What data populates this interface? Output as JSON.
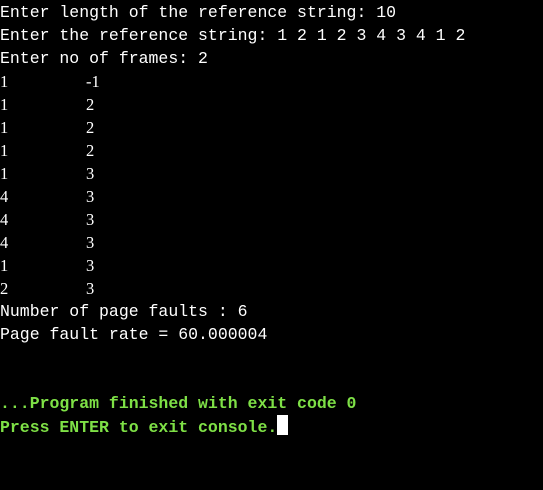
{
  "prompts": {
    "length_prompt": "Enter length of the reference string: 10",
    "string_prompt": "Enter the reference string: 1 2 1 2 3 4 3 4 1 2",
    "frames_prompt": "Enter no of frames: 2"
  },
  "frame_rows": [
    {
      "f1": "1",
      "f2": "-1"
    },
    {
      "f1": "1",
      "f2": "2"
    },
    {
      "f1": "1",
      "f2": "2"
    },
    {
      "f1": "1",
      "f2": "2"
    },
    {
      "f1": "1",
      "f2": "3"
    },
    {
      "f1": "4",
      "f2": "3"
    },
    {
      "f1": "4",
      "f2": "3"
    },
    {
      "f1": "4",
      "f2": "3"
    },
    {
      "f1": "1",
      "f2": "3"
    },
    {
      "f1": "2",
      "f2": "3"
    }
  ],
  "results": {
    "page_faults": "Number of page faults : 6",
    "fault_rate": "Page fault rate = 60.000004"
  },
  "status": {
    "finished": "...Program finished with exit code 0",
    "press_enter": "Press ENTER to exit console."
  },
  "colors": {
    "background": "#000000",
    "text": "#ffffff",
    "status_text": "#7ee046"
  }
}
